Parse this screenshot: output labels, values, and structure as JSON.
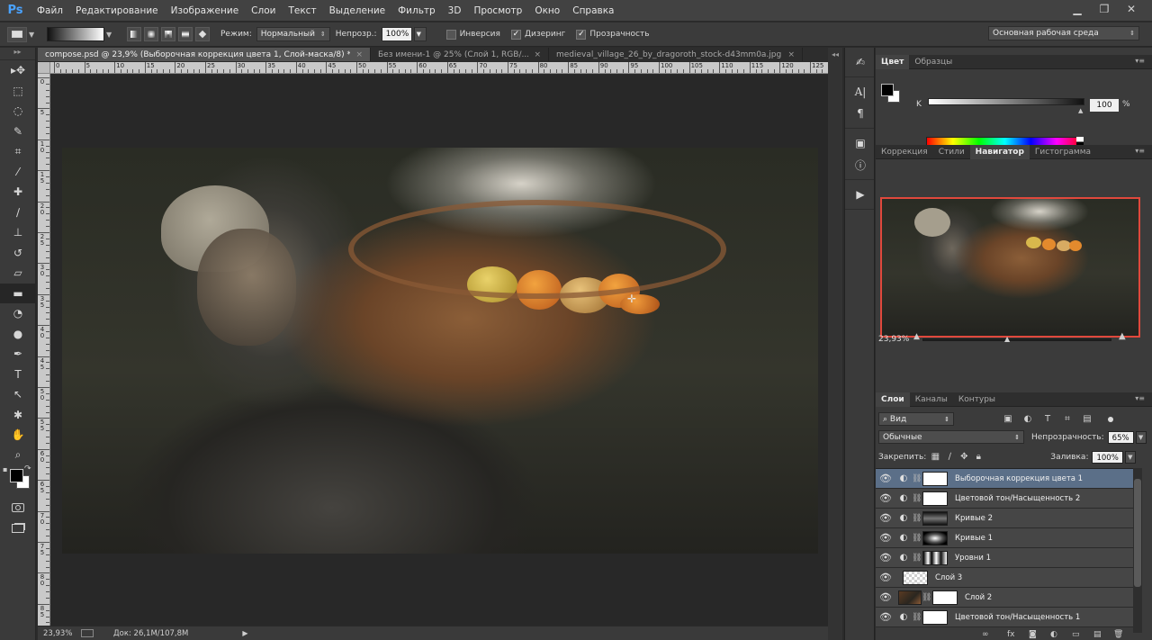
{
  "app": {
    "logo": "Ps",
    "menu": [
      "Файл",
      "Редактирование",
      "Изображение",
      "Слои",
      "Текст",
      "Выделение",
      "Фильтр",
      "3D",
      "Просмотр",
      "Окно",
      "Справка"
    ],
    "window_controls": [
      "minimize",
      "restore",
      "close"
    ]
  },
  "options": {
    "mode_label": "Режим:",
    "mode_value": "Нормальный",
    "opacity_label": "Непрозр.:",
    "opacity_value": "100%",
    "inverse_label": "Инверсия",
    "inverse_checked": false,
    "dither_label": "Дизеринг",
    "dither_checked": true,
    "transparency_label": "Прозрачность",
    "transparency_checked": true,
    "workspace": "Основная рабочая среда"
  },
  "tools": [
    {
      "icon": "move-icon",
      "glyph": "▸✥",
      "active": false
    },
    {
      "icon": "marquee-icon",
      "glyph": "⬚",
      "active": false
    },
    {
      "icon": "lasso-icon",
      "glyph": "◌",
      "active": false
    },
    {
      "icon": "quick-select-icon",
      "glyph": "✎",
      "active": false
    },
    {
      "icon": "crop-icon",
      "glyph": "⌗",
      "active": false
    },
    {
      "icon": "eyedropper-icon",
      "glyph": "⁄",
      "active": false
    },
    {
      "icon": "healing-brush-icon",
      "glyph": "✚",
      "active": false
    },
    {
      "icon": "brush-icon",
      "glyph": "∕",
      "active": false
    },
    {
      "icon": "clone-stamp-icon",
      "glyph": "⊥",
      "active": false
    },
    {
      "icon": "history-brush-icon",
      "glyph": "↺",
      "active": false
    },
    {
      "icon": "eraser-icon",
      "glyph": "▱",
      "active": false
    },
    {
      "icon": "gradient-icon",
      "glyph": "▬",
      "active": true
    },
    {
      "icon": "blur-icon",
      "glyph": "◔",
      "active": false
    },
    {
      "icon": "dodge-icon",
      "glyph": "●",
      "active": false
    },
    {
      "icon": "pen-icon",
      "glyph": "✒",
      "active": false
    },
    {
      "icon": "type-icon",
      "glyph": "T",
      "active": false
    },
    {
      "icon": "path-select-icon",
      "glyph": "↖",
      "active": false
    },
    {
      "icon": "shape-icon",
      "glyph": "✱",
      "active": false
    },
    {
      "icon": "hand-icon",
      "glyph": "✋",
      "active": false
    },
    {
      "icon": "zoom-icon",
      "glyph": "⌕",
      "active": false
    }
  ],
  "document": {
    "tabs": [
      {
        "label": "compose.psd @ 23,9% (Выборочная коррекция цвета 1, Слой-маска/8) *",
        "active": true
      },
      {
        "label": "Без имени-1 @ 25% (Слой 1, RGB/...",
        "active": false
      },
      {
        "label": "medieval_village_26_by_dragoroth_stock-d43mm0a.jpg...",
        "active": false
      }
    ],
    "ruler_h": [
      "0",
      "5",
      "10",
      "15",
      "20",
      "25",
      "30",
      "35",
      "40",
      "45",
      "50",
      "55",
      "60",
      "65",
      "70",
      "75",
      "80",
      "85",
      "90",
      "95",
      "100",
      "105",
      "110",
      "115",
      "120",
      "125"
    ],
    "ruler_v": [
      "0",
      "5",
      "1\n0",
      "1\n5",
      "2\n0",
      "2\n5",
      "3\n0",
      "3\n5",
      "4\n0",
      "4\n5",
      "5\n0",
      "5\n5",
      "6\n0",
      "6\n5",
      "7\n0",
      "7\n5",
      "8\n0",
      "8\n5"
    ],
    "status_zoom": "23,93%",
    "status_doc": "Док: 26,1M/107,8M"
  },
  "dock_icons": [
    "tools-history-icon",
    "character-icon",
    "paragraph-icon",
    "info-icon",
    "properties-icon",
    "actions-play-icon"
  ],
  "color_panel": {
    "tabs": [
      {
        "label": "Цвет",
        "active": true
      },
      {
        "label": "Образцы",
        "active": false
      }
    ],
    "channel": "K",
    "value": "100",
    "unit": "%",
    "fg_color": "#000000",
    "bg_color": "#ffffff"
  },
  "nav_panel": {
    "tabs": [
      {
        "label": "Коррекция",
        "active": false
      },
      {
        "label": "Стили",
        "active": false
      },
      {
        "label": "Навигатор",
        "active": true
      },
      {
        "label": "Гистограмма",
        "active": false
      }
    ],
    "zoom": "23,93%",
    "highlight_color": "#e0483c"
  },
  "layers_panel": {
    "tabs": [
      {
        "label": "Слои",
        "active": true
      },
      {
        "label": "Каналы",
        "active": false
      },
      {
        "label": "Контуры",
        "active": false
      }
    ],
    "filter_kind": "Вид",
    "blend_mode": "Обычные",
    "opacity_label": "Непрозрачность:",
    "opacity_value": "65%",
    "lock_label": "Закрепить:",
    "fill_label": "Заливка:",
    "fill_value": "100%",
    "layers": [
      {
        "name": "Выборочная коррекция цвета 1",
        "adjustment": true,
        "thumb": "white",
        "selected": true
      },
      {
        "name": "Цветовой тон/Насыщенность 2",
        "adjustment": true,
        "thumb": "white",
        "selected": false
      },
      {
        "name": "Кривые 2",
        "adjustment": true,
        "thumb": "dark-gradient",
        "selected": false
      },
      {
        "name": "Кривые 1",
        "adjustment": true,
        "thumb": "radial-mask",
        "selected": false
      },
      {
        "name": "Уровни 1",
        "adjustment": true,
        "thumb": "bw-mask",
        "selected": false
      },
      {
        "name": "Слой 3",
        "adjustment": false,
        "thumb": "transparent",
        "selected": false
      },
      {
        "name": "Слой 2",
        "adjustment": false,
        "thumb": "photo-mask",
        "selected": false
      },
      {
        "name": "Цветовой тон/Насыщенность 1",
        "adjustment": true,
        "thumb": "white",
        "selected": false
      }
    ]
  }
}
